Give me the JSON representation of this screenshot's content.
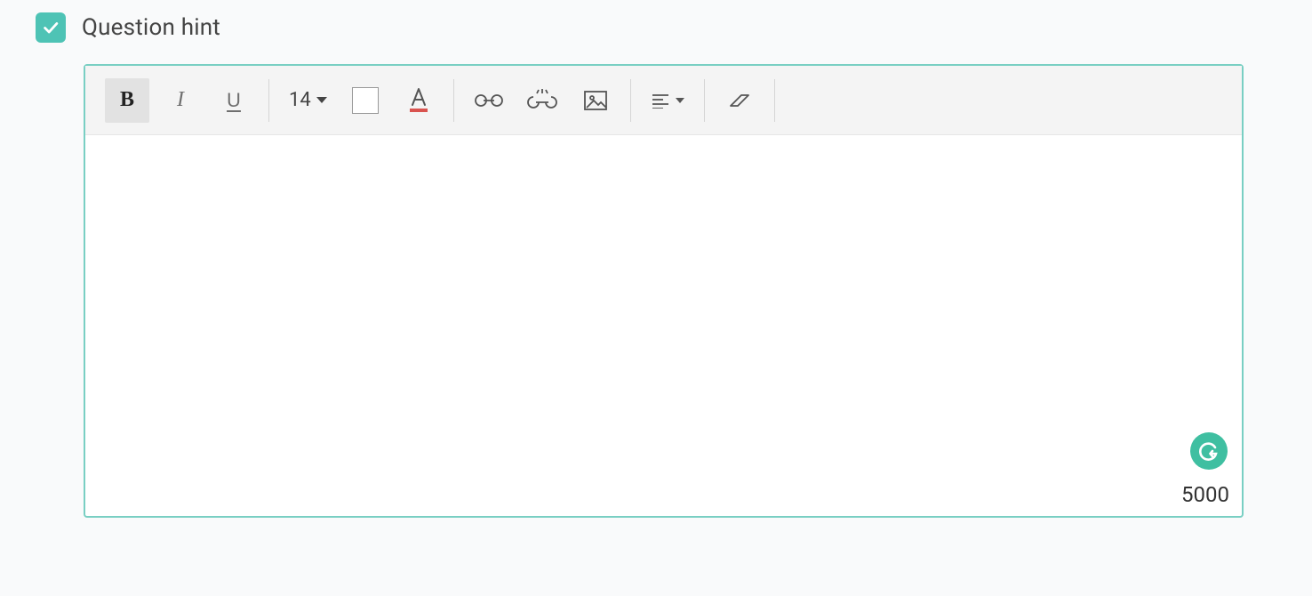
{
  "checkbox": {
    "checked": true
  },
  "label": "Question hint",
  "toolbar": {
    "font_size": "14"
  },
  "char_limit": "5000",
  "icons": {
    "bold": "B",
    "italic": "I",
    "underline": "U"
  }
}
